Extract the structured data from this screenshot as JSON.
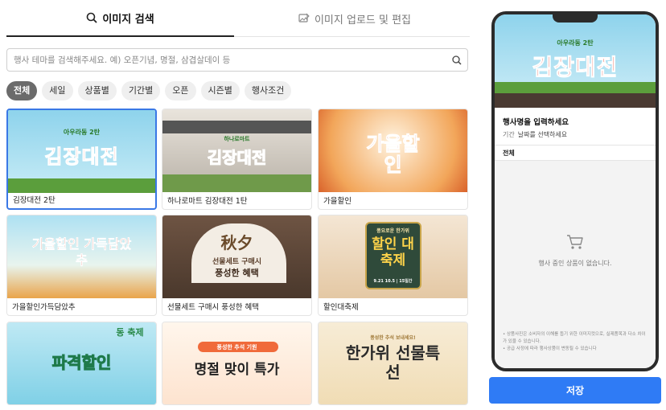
{
  "tabs": {
    "search": "이미지 검색",
    "upload": "이미지 업로드 및 편집"
  },
  "search": {
    "placeholder": "행사 테마를 검색해주세요. 예) 오픈기념, 명절, 삼겹살데이 등",
    "value": ""
  },
  "chips": [
    "전체",
    "세일",
    "상품별",
    "기간별",
    "오픈",
    "시즌별",
    "행사조건"
  ],
  "cards": [
    {
      "caption": "김장대전 2탄",
      "title": "김장대전",
      "badge": "아우라동 2탄"
    },
    {
      "caption": "하나로마트 김장대전 1탄",
      "title": "김장대전",
      "badge": "하나로마트"
    },
    {
      "caption": "가을할인",
      "title": "가을할인"
    },
    {
      "caption": "가을할인가득담았추",
      "title": "가을할인 가득담았추"
    },
    {
      "caption": "선물세트 구매시 풍성한 혜택",
      "title": "秋夕",
      "sub1": "선물세트 구매시",
      "sub2": "풍성한 혜택"
    },
    {
      "caption": "할인대축제",
      "title": "할인 대축제",
      "badge": "풍요로운 한가위",
      "date": "9.21 10.5 | 15일간"
    },
    {
      "caption": "",
      "title": "파격할인",
      "badge": "동 축제"
    },
    {
      "caption": "",
      "title": "명절 맞이 특가",
      "badge": "풍성한 추석 기원"
    },
    {
      "caption": "",
      "title": "한가위 선물특선",
      "badge": "풍성한 추석 보내세요!"
    }
  ],
  "preview": {
    "banner_title": "김장대전",
    "banner_badge": "아우라동 2탄",
    "name_placeholder": "행사명을 입력하세요",
    "date_label": "기간",
    "date_placeholder": "날짜를 선택하세요",
    "tab": "전체",
    "empty": "행사 중인 상품이 없습니다.",
    "note1": "• 상품사진은 소비자의 이해를 돕기 위한 이미지컷으로, 실제품목과 다소 차이가 있을 수 있습니다.",
    "note2": "• 공급 사정에 따라 행사상품이 변동될 수 있습니다"
  },
  "save_label": "저장",
  "colors": {
    "accent": "#2f7bf5",
    "selected_border": "#3a78e6"
  },
  "icons": {
    "search_tab": "search-icon",
    "upload_tab": "image-edit-icon",
    "cart": "cart-icon"
  }
}
